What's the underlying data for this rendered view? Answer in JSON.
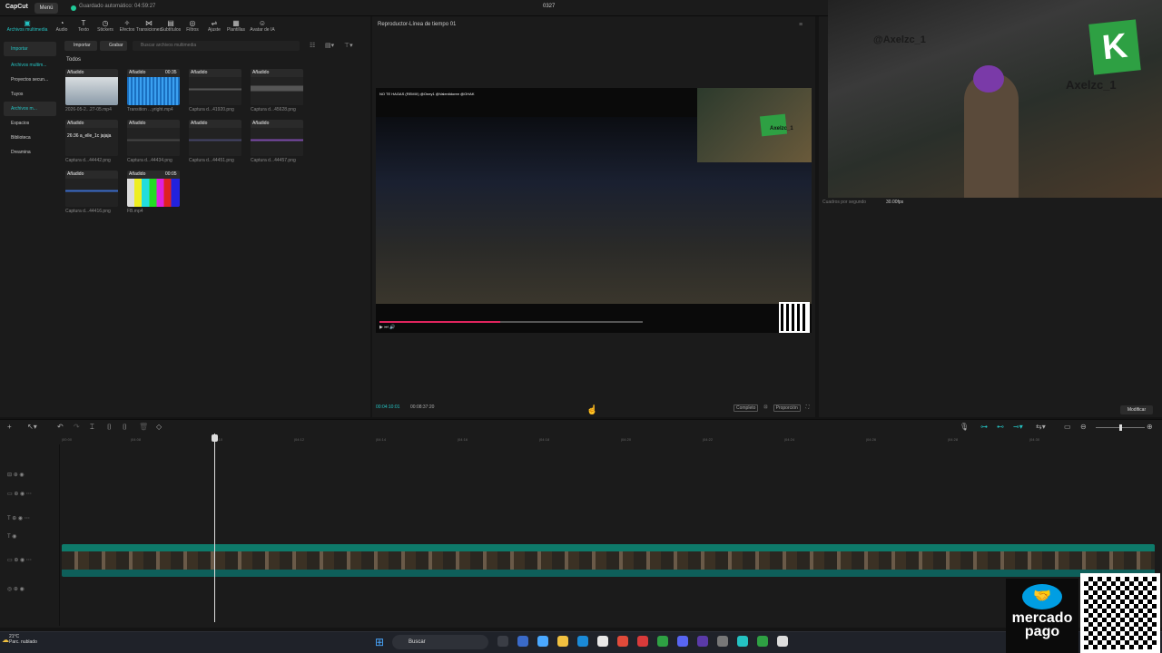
{
  "app": {
    "logo": "CapCut",
    "menu_label": "Menú",
    "autosave": "Guardado automático: 04:59:27",
    "project_title": "0327"
  },
  "media_tabs": [
    {
      "label": "Archivos multimedia",
      "icon": "media-icon"
    },
    {
      "label": "Audio",
      "icon": "audio-icon"
    },
    {
      "label": "Texto",
      "icon": "text-icon"
    },
    {
      "label": "Stickers",
      "icon": "sticker-icon"
    },
    {
      "label": "Efectos",
      "icon": "effects-icon"
    },
    {
      "label": "Transiciones",
      "icon": "transition-icon"
    },
    {
      "label": "Subtítulos",
      "icon": "captions-icon"
    },
    {
      "label": "Filtros",
      "icon": "filter-icon"
    },
    {
      "label": "Ajuste",
      "icon": "adjust-icon"
    },
    {
      "label": "Plantillas",
      "icon": "template-icon"
    },
    {
      "label": "Avatar de IA",
      "icon": "ai-avatar-icon"
    }
  ],
  "sidebar": {
    "items": [
      "Importar",
      "Archivos multim...",
      "Proyectos secun...",
      "Tuyos",
      "Archivos m...",
      "Espacios",
      "Biblioteca",
      "Dreamina"
    ]
  },
  "media_toolbar": {
    "import_label": "Importar",
    "record_label": "Grabar",
    "search_placeholder": "Buscar archivos multimedia"
  },
  "media": {
    "filter_label": "Todos",
    "added_tag": "Añadido",
    "items": [
      {
        "name": "2026-05-2...27-05.mp4"
      },
      {
        "name": "Transition ...yright.mp4",
        "duration": "00:35"
      },
      {
        "name": "Captura d...41920.png"
      },
      {
        "name": "Captura d...45628.png"
      },
      {
        "name": "Captura d...44442.png",
        "caption": "26:36 a_elle_1c jajaja"
      },
      {
        "name": "Captura d...44434.png"
      },
      {
        "name": "Captura d...44451.png"
      },
      {
        "name": "Captura d...44457.png"
      },
      {
        "name": "Captura d...44416.png"
      },
      {
        "name": "FB.mp4",
        "duration": "00:05"
      }
    ]
  },
  "player": {
    "title": "Reproductor-Línea de tiempo 01",
    "video_overlay_text": "NO TE HAGAS (REMIX) @Oney1 @Valentidoree @OHAK",
    "webcam_handle": "Axelzc_1",
    "current_time": "00:04:10:01",
    "total_time": "00:08:37:20",
    "ratio_label": "Completo",
    "ratio_label2": "Proporción",
    "progress_fraction": 0.46
  },
  "webcam": {
    "handle": "@Axelzc_1",
    "brand": "Axelzc_1",
    "logo_letter": "K"
  },
  "details": {
    "fps_label": "Cuadros por segundo",
    "fps_value": "30.00fps",
    "modify_label": "Modificar"
  },
  "ruler_ticks": [
    "|00:00",
    "|04:08",
    "|04:10",
    "|04:12",
    "|04:14",
    "|04:16",
    "|04:18",
    "|04:20",
    "|04:22",
    "|04:24",
    "|04:26",
    "|04:28",
    "|04:30"
  ],
  "taskbar": {
    "weather_temp": "21°C",
    "weather_desc": "Parc. nublado",
    "search_label": "Buscar"
  },
  "overlay": {
    "mp_line1": "mercado",
    "mp_line2": "pago"
  },
  "colors": {
    "accent": "#25c3c3",
    "clip_green": "#0e7a6a",
    "progress_red": "#e0245e",
    "mp_blue": "#009ee3"
  }
}
